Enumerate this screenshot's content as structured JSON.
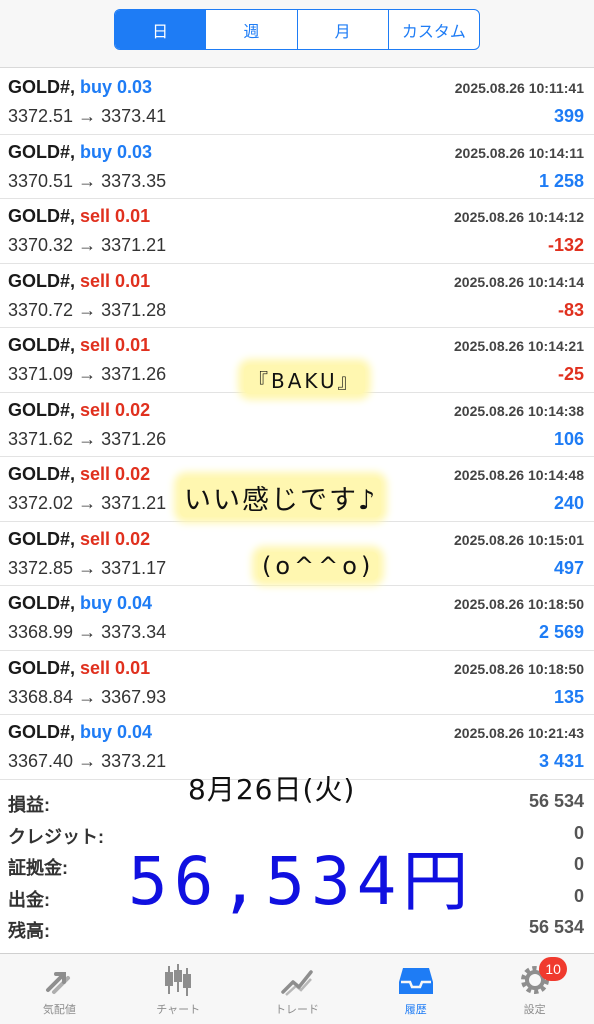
{
  "tabs_top": [
    "日",
    "週",
    "月",
    "カスタム"
  ],
  "trades": [
    {
      "symbol": "GOLD#,",
      "side": "buy",
      "volume": "buy 0.03",
      "time": "2025.08.26 10:11:41",
      "prices": "3372.51 → 3373.41",
      "profit": "399",
      "sign": "pos"
    },
    {
      "symbol": "GOLD#,",
      "side": "buy",
      "volume": "buy 0.03",
      "time": "2025.08.26 10:14:11",
      "prices": "3370.51 → 3373.35",
      "profit": "1 258",
      "sign": "pos"
    },
    {
      "symbol": "GOLD#,",
      "side": "sell",
      "volume": "sell 0.01",
      "time": "2025.08.26 10:14:12",
      "prices": "3370.32 → 3371.21",
      "profit": "-132",
      "sign": "neg"
    },
    {
      "symbol": "GOLD#,",
      "side": "sell",
      "volume": "sell 0.01",
      "time": "2025.08.26 10:14:14",
      "prices": "3370.72 → 3371.28",
      "profit": "-83",
      "sign": "neg"
    },
    {
      "symbol": "GOLD#,",
      "side": "sell",
      "volume": "sell 0.01",
      "time": "2025.08.26 10:14:21",
      "prices": "3371.09 → 3371.26",
      "profit": "-25",
      "sign": "neg"
    },
    {
      "symbol": "GOLD#,",
      "side": "sell",
      "volume": "sell 0.02",
      "time": "2025.08.26 10:14:38",
      "prices": "3371.62 → 3371.26",
      "profit": "106",
      "sign": "pos"
    },
    {
      "symbol": "GOLD#,",
      "side": "sell",
      "volume": "sell 0.02",
      "time": "2025.08.26 10:14:48",
      "prices": "3372.02 → 3371.21",
      "profit": "240",
      "sign": "pos"
    },
    {
      "symbol": "GOLD#,",
      "side": "sell",
      "volume": "sell 0.02",
      "time": "2025.08.26 10:15:01",
      "prices": "3372.85 → 3371.17",
      "profit": "497",
      "sign": "pos"
    },
    {
      "symbol": "GOLD#,",
      "side": "buy",
      "volume": "buy 0.04",
      "time": "2025.08.26 10:18:50",
      "prices": "3368.99 → 3373.34",
      "profit": "2 569",
      "sign": "pos"
    },
    {
      "symbol": "GOLD#,",
      "side": "sell",
      "volume": "sell 0.01",
      "time": "2025.08.26 10:18:50",
      "prices": "3368.84 → 3367.93",
      "profit": "135",
      "sign": "pos"
    },
    {
      "symbol": "GOLD#,",
      "side": "buy",
      "volume": "buy 0.04",
      "time": "2025.08.26 10:21:43",
      "prices": "3367.40 → 3373.21",
      "profit": "3 431",
      "sign": "pos"
    }
  ],
  "summary": [
    {
      "label": "損益:",
      "value": "56 534"
    },
    {
      "label": "クレジット:",
      "value": "0"
    },
    {
      "label": "証拠金:",
      "value": "0"
    },
    {
      "label": "出金:",
      "value": "0"
    },
    {
      "label": "残高:",
      "value": "56 534"
    }
  ],
  "annotations": {
    "baku": "『BAKU』",
    "feeling": "いい感じです♪",
    "face": "(o^^o)",
    "date": "8月26日(火)",
    "amount": "56,534円"
  },
  "tabbar": [
    {
      "label": "気配値",
      "icon": "quotes-arrows-icon",
      "active": false
    },
    {
      "label": "チャート",
      "icon": "candlestick-chart-icon",
      "active": false
    },
    {
      "label": "トレード",
      "icon": "trade-line-icon",
      "active": false
    },
    {
      "label": "履歴",
      "icon": "inbox-tray-icon",
      "active": true
    },
    {
      "label": "設定",
      "icon": "gear-icon",
      "active": false,
      "badge": "10"
    }
  ],
  "colors": {
    "accent": "#1e7cf5",
    "sell": "#e0301e",
    "badge": "#f03a2e",
    "handwriting_amount": "#1010e0"
  }
}
